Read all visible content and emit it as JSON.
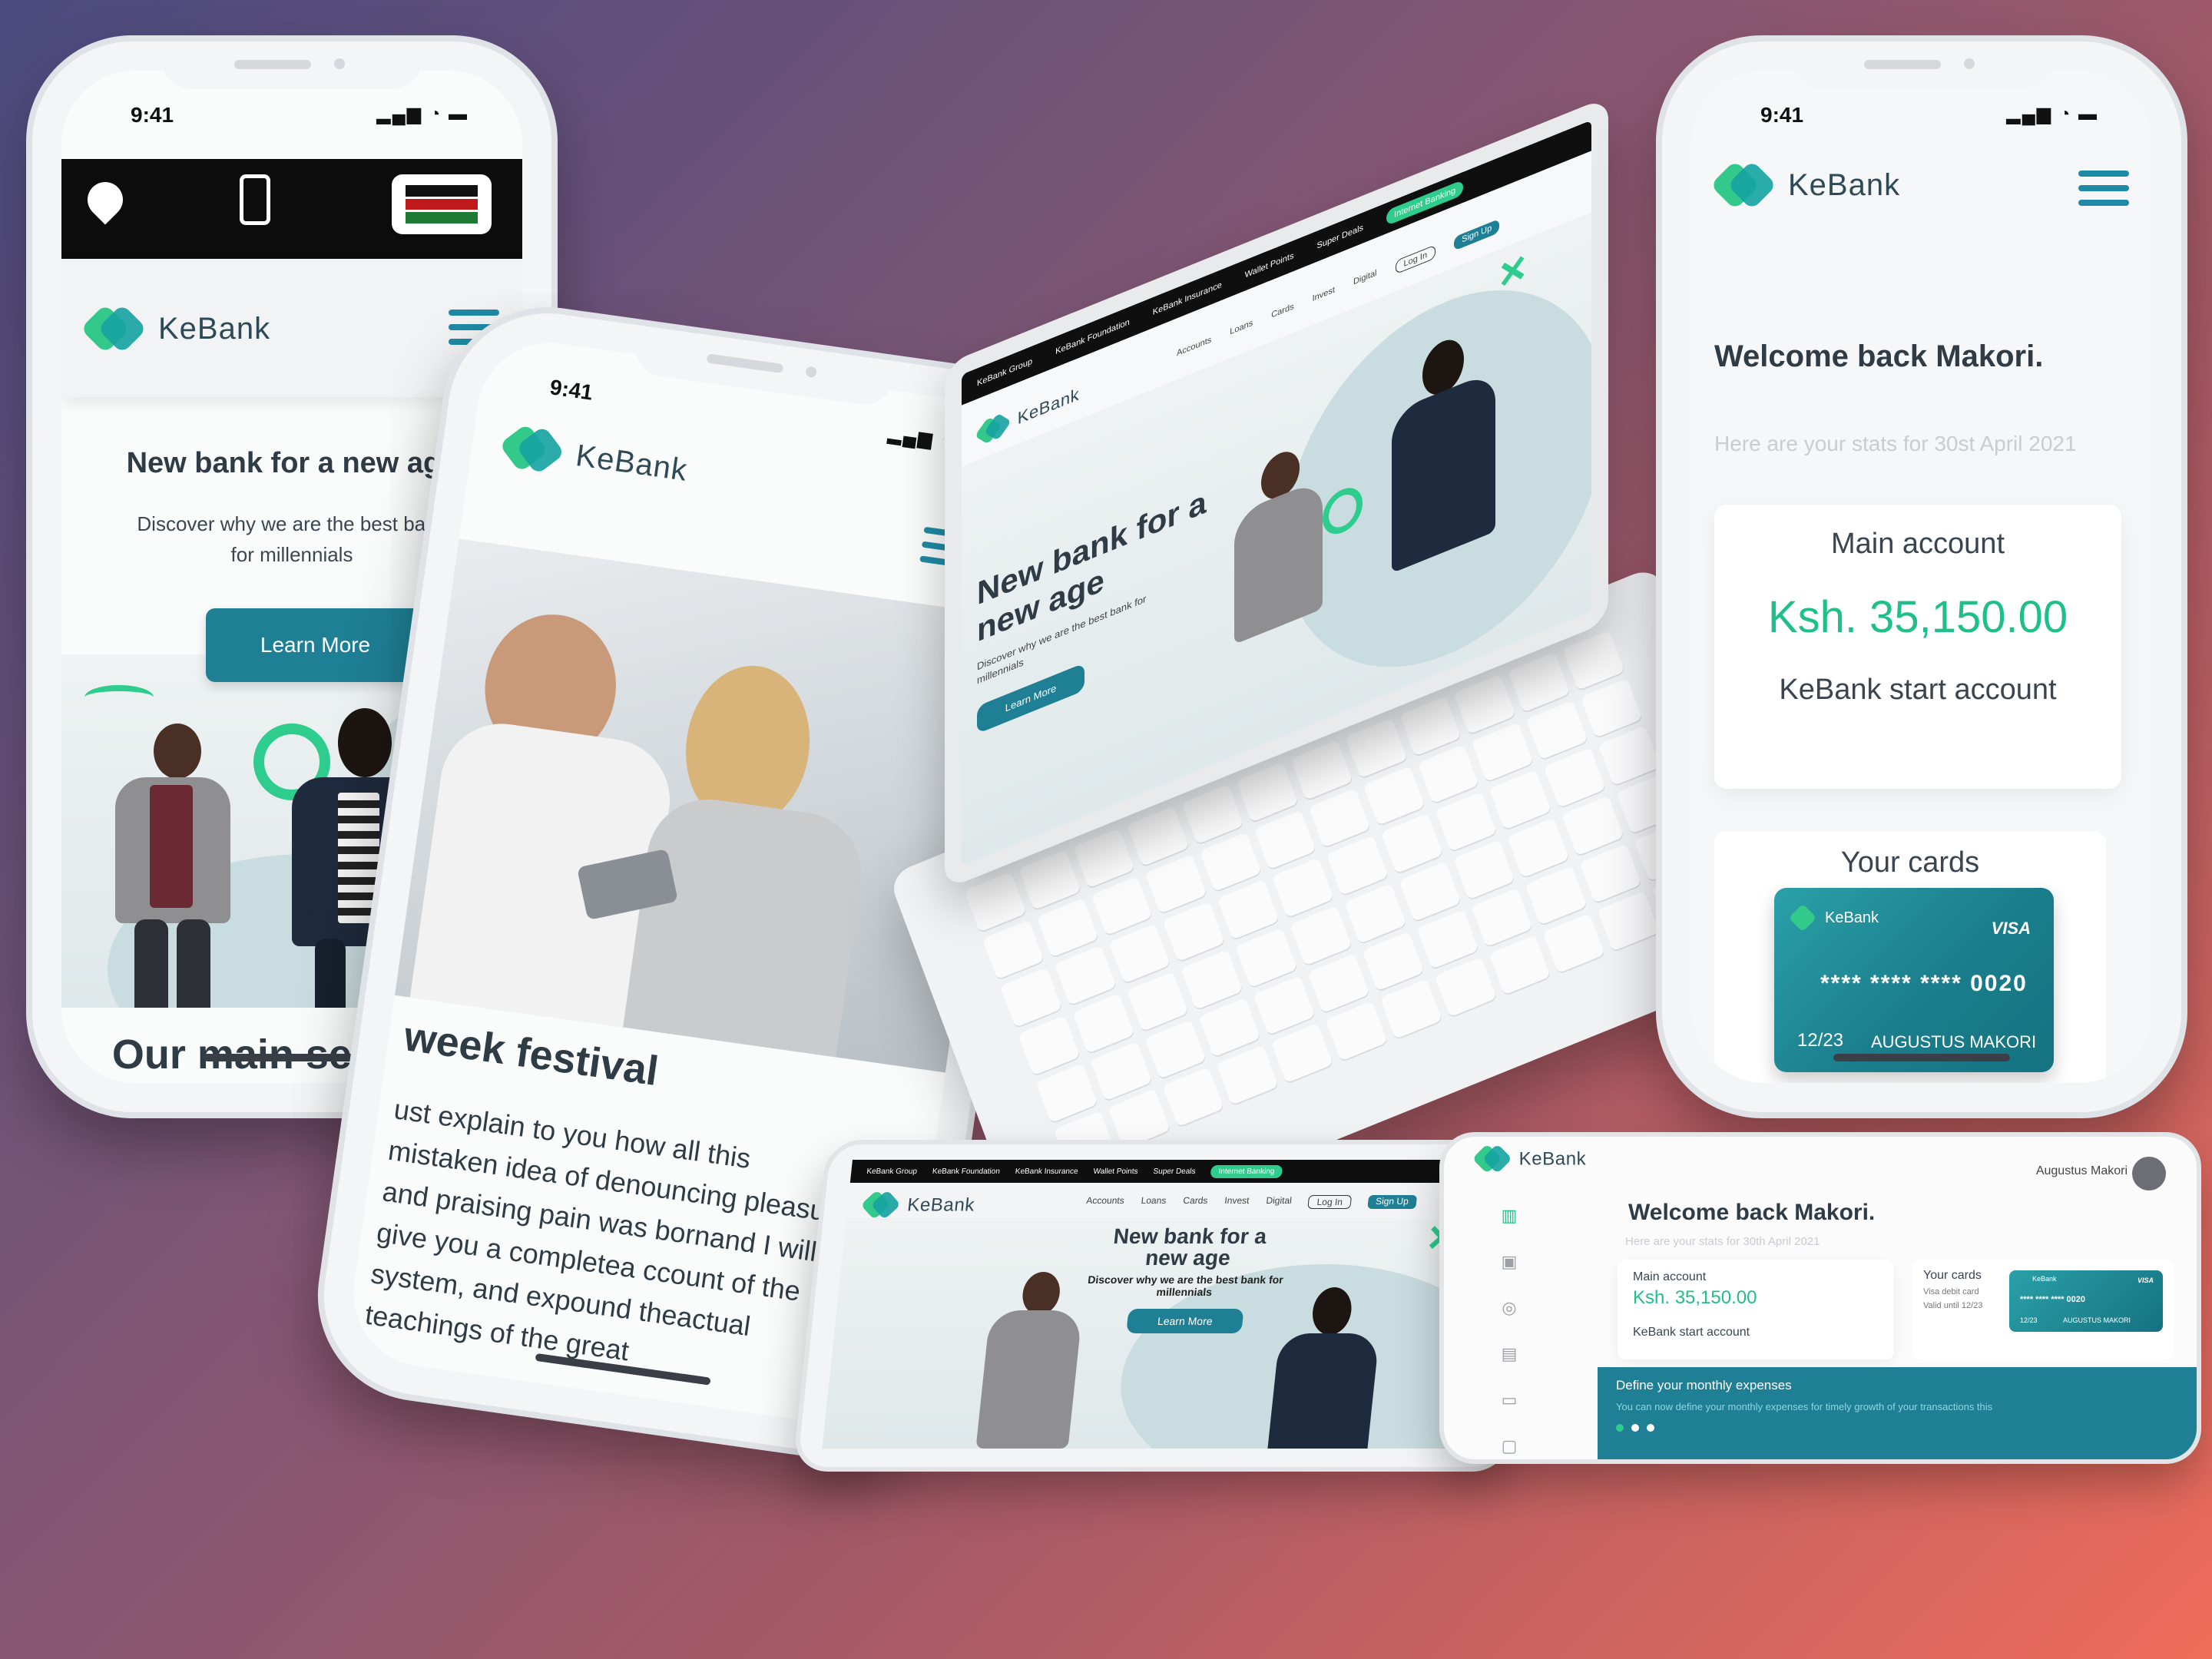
{
  "brand": {
    "name": "KeBank",
    "green": "#33c98b",
    "teal": "#1f7f95"
  },
  "phone1": {
    "time": "9:41",
    "status": "▂▄▆ ◔ ▬",
    "topbar_icons": [
      "location-pin-icon",
      "mobile-phone-icon",
      "kenya-flag-icon"
    ],
    "hero_title": "New bank for a new age",
    "hero_subtitle": "Discover why we are the best bank for millennials",
    "cta": "Learn More",
    "section_title": "Our main services"
  },
  "phone2": {
    "time": "9:41",
    "status": "▂▄▆ ◔ ▬",
    "heading_partial": "week festival",
    "body": "ust explain to you how all this mistaken idea of denouncing pleasure and praising pain was bornand I will give you a completea ccount of the system, and expound theactual teachings of the great"
  },
  "laptop": {
    "topnav": [
      "KeBank Group",
      "KeBank Foundation",
      "KeBank Insurance",
      "Wallet Points",
      "Super Deals"
    ],
    "internet_banking": "Internet Banking",
    "menu": [
      "Accounts",
      "Loans",
      "Cards",
      "Invest",
      "Digital"
    ],
    "login": "Log In",
    "signup": "Sign Up",
    "hero_title": "New bank for a new age",
    "hero_subtitle": "Discover why we are the best bank for millennials",
    "cta": "Learn More"
  },
  "phone3": {
    "time": "9:41",
    "status": "▂▄▆ ◔ ▬",
    "welcome": "Welcome back Makori.",
    "stats_note": "Here are your stats for 30st April 2021",
    "account_label": "Main account",
    "account_balance": "Ksh. 35,150.00",
    "account_type": "KeBank start account",
    "cards_title": "Your cards",
    "card": {
      "brand": "KeBank",
      "network": "VISA",
      "number": "**** **** **** 0020",
      "expiry": "12/23",
      "holder": "AUGUSTUS MAKORI"
    }
  },
  "tablet1": {
    "topnav": [
      "KeBank Group",
      "KeBank Foundation",
      "KeBank Insurance",
      "Wallet Points",
      "Super Deals"
    ],
    "internet_banking": "Internet Banking",
    "menu": [
      "Accounts",
      "Loans",
      "Cards",
      "Invest",
      "Digital"
    ],
    "login": "Log In",
    "signup": "Sign Up",
    "hero_title": "New bank for a new age",
    "hero_subtitle": "Discover why we are the best bank for millennials",
    "cta": "Learn More"
  },
  "tablet2": {
    "user": "Augustus Makori",
    "welcome": "Welcome back Makori.",
    "stats_note": "Here are your stats for 30th April 2021",
    "account_label": "Main account",
    "account_balance": "Ksh. 35,150.00",
    "account_type": "KeBank start account",
    "cards_title": "Your cards",
    "cards_lines": [
      "Visa debit card",
      "Valid until 12/23"
    ],
    "card": {
      "brand": "KeBank",
      "network": "VISA",
      "number": "**** **** **** 0020",
      "expiry": "12/23",
      "holder": "AUGUSTUS MAKORI"
    },
    "banner_title": "Define your monthly expenses",
    "banner_text": "You can now define your monthly expenses for timely growth of your transactions this",
    "sidebar_icons": [
      "bank-icon",
      "id-card-icon",
      "coin-icon",
      "wallet-icon",
      "card-icon",
      "briefcase-icon"
    ]
  }
}
